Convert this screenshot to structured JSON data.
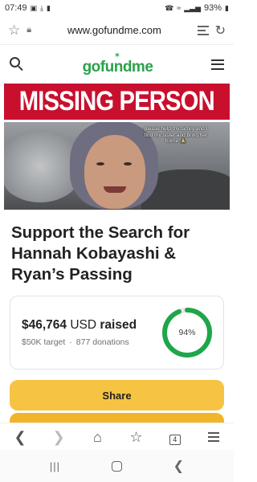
{
  "status_bar": {
    "time": "07:49",
    "battery": "93%"
  },
  "browser": {
    "url": "www.gofundme.com",
    "tab_count": "4"
  },
  "site": {
    "logo_text": "gofundme"
  },
  "hero": {
    "banner_text": "MISSING PERSON",
    "caption": "please help my family and I find my sister and bring her home 🙏"
  },
  "campaign": {
    "title": "Support the Search for Hannah Kobayashi & Ryan’s Passing",
    "raised_amount": "$46,764",
    "currency": "USD",
    "raised_label": "raised",
    "target": "$50K target",
    "donations": "877 donations",
    "progress_label": "94%",
    "progress_fraction": 0.94
  },
  "buttons": {
    "share": "Share"
  },
  "colors": {
    "brand_green": "#2aa24a",
    "progress_green": "#1fa64a",
    "share_yellow": "#f6c342",
    "banner_red": "#c8102e"
  },
  "icons": {
    "status_left": [
      "image-icon",
      "download-icon",
      "sim-icon"
    ],
    "status_right": [
      "alarm-icon",
      "wifi-icon",
      "signal-icon",
      "battery-icon"
    ],
    "url_bar": [
      "bookmark-star-icon",
      "lock-icon",
      "reader-mode-icon",
      "refresh-icon"
    ],
    "toolbar": [
      "back-icon",
      "forward-icon",
      "home-icon",
      "bookmarks-icon",
      "tabs-icon",
      "menu-icon"
    ],
    "system_nav": [
      "recents-icon",
      "home-nav-icon",
      "back-nav-icon"
    ]
  }
}
